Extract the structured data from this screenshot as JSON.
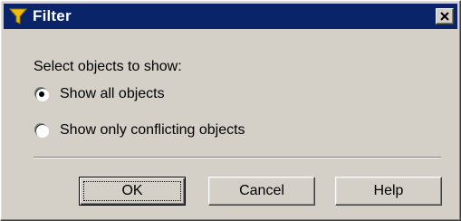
{
  "window": {
    "title": "Filter",
    "title_icon": "filter-funnel-icon",
    "close_icon": "close-icon"
  },
  "content": {
    "prompt": "Select objects to show:",
    "options": [
      {
        "label": "Show all objects",
        "selected": true
      },
      {
        "label": "Show only conflicting objects",
        "selected": false
      }
    ]
  },
  "buttons": {
    "ok": "OK",
    "cancel": "Cancel",
    "help": "Help"
  },
  "colors": {
    "titlebar": "#0a246a",
    "face": "#d4d0c8",
    "funnel": "#f0c000"
  }
}
